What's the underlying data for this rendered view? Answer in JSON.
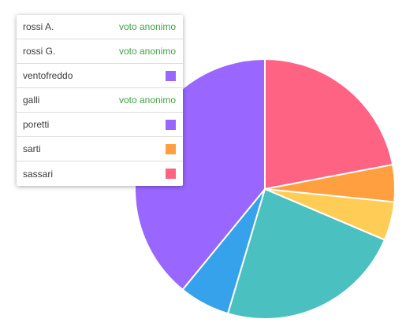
{
  "colors": {
    "anonymous_text": "#43a047"
  },
  "chart_data": {
    "type": "pie",
    "title": "",
    "legend_placement": "top-left",
    "slices": [
      {
        "value": 22.0,
        "color": "#ff6384"
      },
      {
        "value": 4.6,
        "color": "#ff9f40"
      },
      {
        "value": 4.8,
        "color": "#ffcd56"
      },
      {
        "value": 23.2,
        "color": "#4bc0c0"
      },
      {
        "value": 6.3,
        "color": "#36a2eb"
      },
      {
        "value": 39.1,
        "color": "#9966ff"
      }
    ]
  },
  "votes": [
    {
      "name": "rossi A.",
      "anonymous_label": "voto anonimo",
      "color": ""
    },
    {
      "name": "rossi G.",
      "anonymous_label": "voto anonimo",
      "color": ""
    },
    {
      "name": "ventofreddo",
      "anonymous_label": "",
      "color": "#9966ff"
    },
    {
      "name": "galli",
      "anonymous_label": "voto anonimo",
      "color": ""
    },
    {
      "name": "poretti",
      "anonymous_label": "",
      "color": "#9966ff"
    },
    {
      "name": "sarti",
      "anonymous_label": "",
      "color": "#ff9f40"
    },
    {
      "name": "sassari",
      "anonymous_label": "",
      "color": "#ff6384"
    }
  ]
}
